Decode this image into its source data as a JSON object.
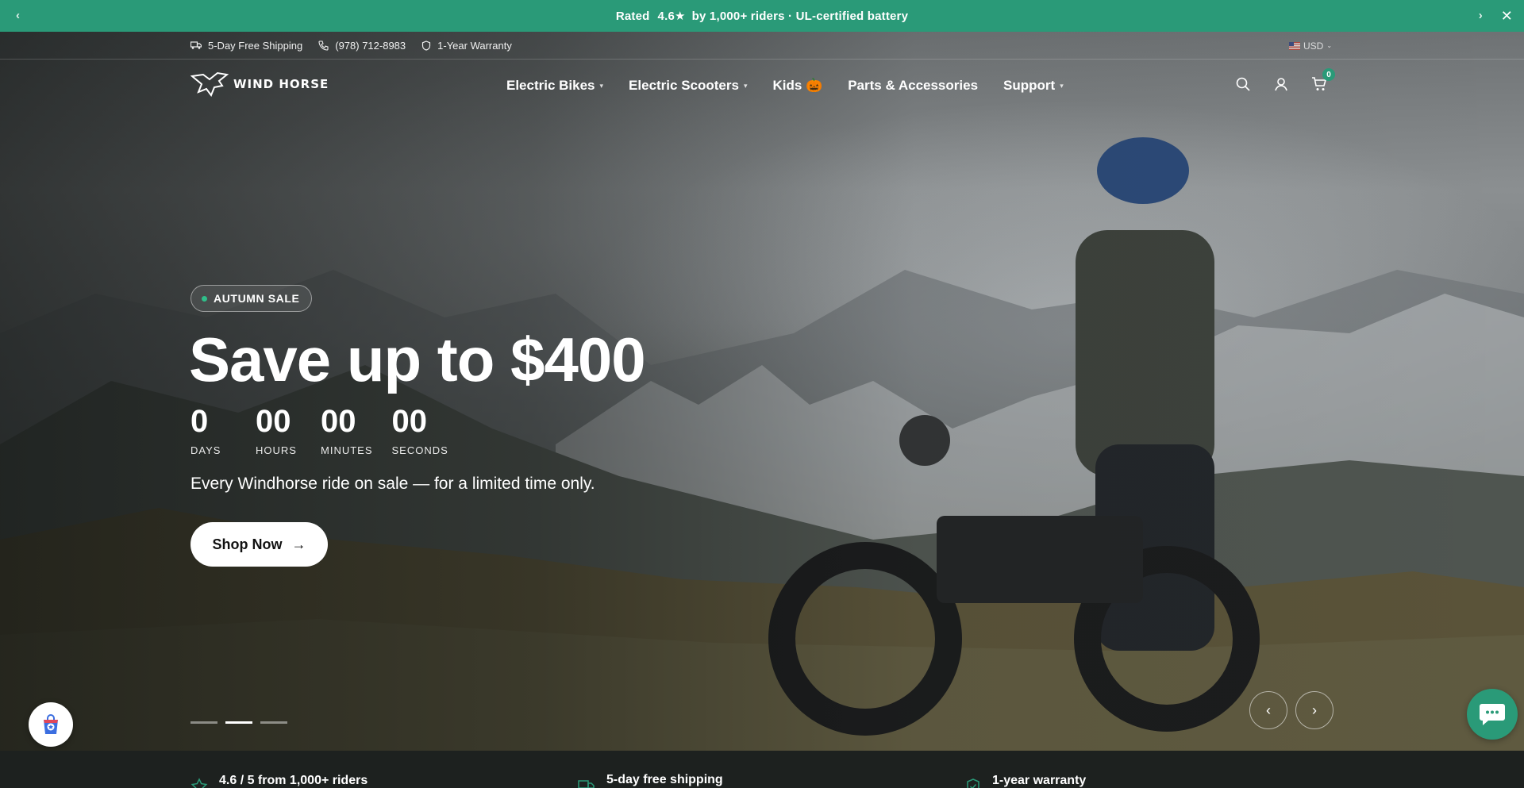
{
  "announcement": {
    "prefix": "Rated",
    "rating": "4.6★",
    "suffix": "by 1,000+ riders · UL-certified battery",
    "prev_label": "‹",
    "next_label": "›",
    "close_label": "✕"
  },
  "utility": {
    "shipping": "5-Day Free Shipping",
    "phone": "(978) 712-8983",
    "warranty": "1-Year Warranty",
    "currency": "USD"
  },
  "brand": {
    "logo_text": "WIND HORSE"
  },
  "nav": {
    "items": [
      {
        "label": "Electric Bikes",
        "has_dropdown": true
      },
      {
        "label": "Electric Scooters",
        "has_dropdown": true
      },
      {
        "label": "Kids 🎃",
        "has_dropdown": false
      },
      {
        "label": "Parts & Accessories",
        "has_dropdown": false
      },
      {
        "label": "Support",
        "has_dropdown": true
      }
    ],
    "cart_count": "0"
  },
  "hero": {
    "badge": "AUTUMN SALE",
    "headline": "Save up to $400",
    "countdown": [
      {
        "value": "0",
        "label": "DAYS"
      },
      {
        "value": "00",
        "label": "HOURS"
      },
      {
        "value": "00",
        "label": "MINUTES"
      },
      {
        "value": "00",
        "label": "SECONDS"
      }
    ],
    "subline": "Every Windhorse ride on sale — for a limited time only.",
    "cta": "Shop Now",
    "cta_arrow": "→",
    "active_slide": 2,
    "slide_count": 3,
    "prev_arrow": "‹",
    "next_arrow": "›"
  },
  "trust": {
    "items": [
      {
        "label": "4.6 / 5 from 1,000+ riders",
        "icon": "star-icon"
      },
      {
        "label": "5-day free shipping",
        "icon": "truck-icon"
      },
      {
        "label": "1-year warranty",
        "icon": "shield-check-icon"
      }
    ]
  },
  "colors": {
    "accent": "#2a9a78",
    "trust_bg": "#1d211f",
    "cta_bg": "#ffffff"
  }
}
